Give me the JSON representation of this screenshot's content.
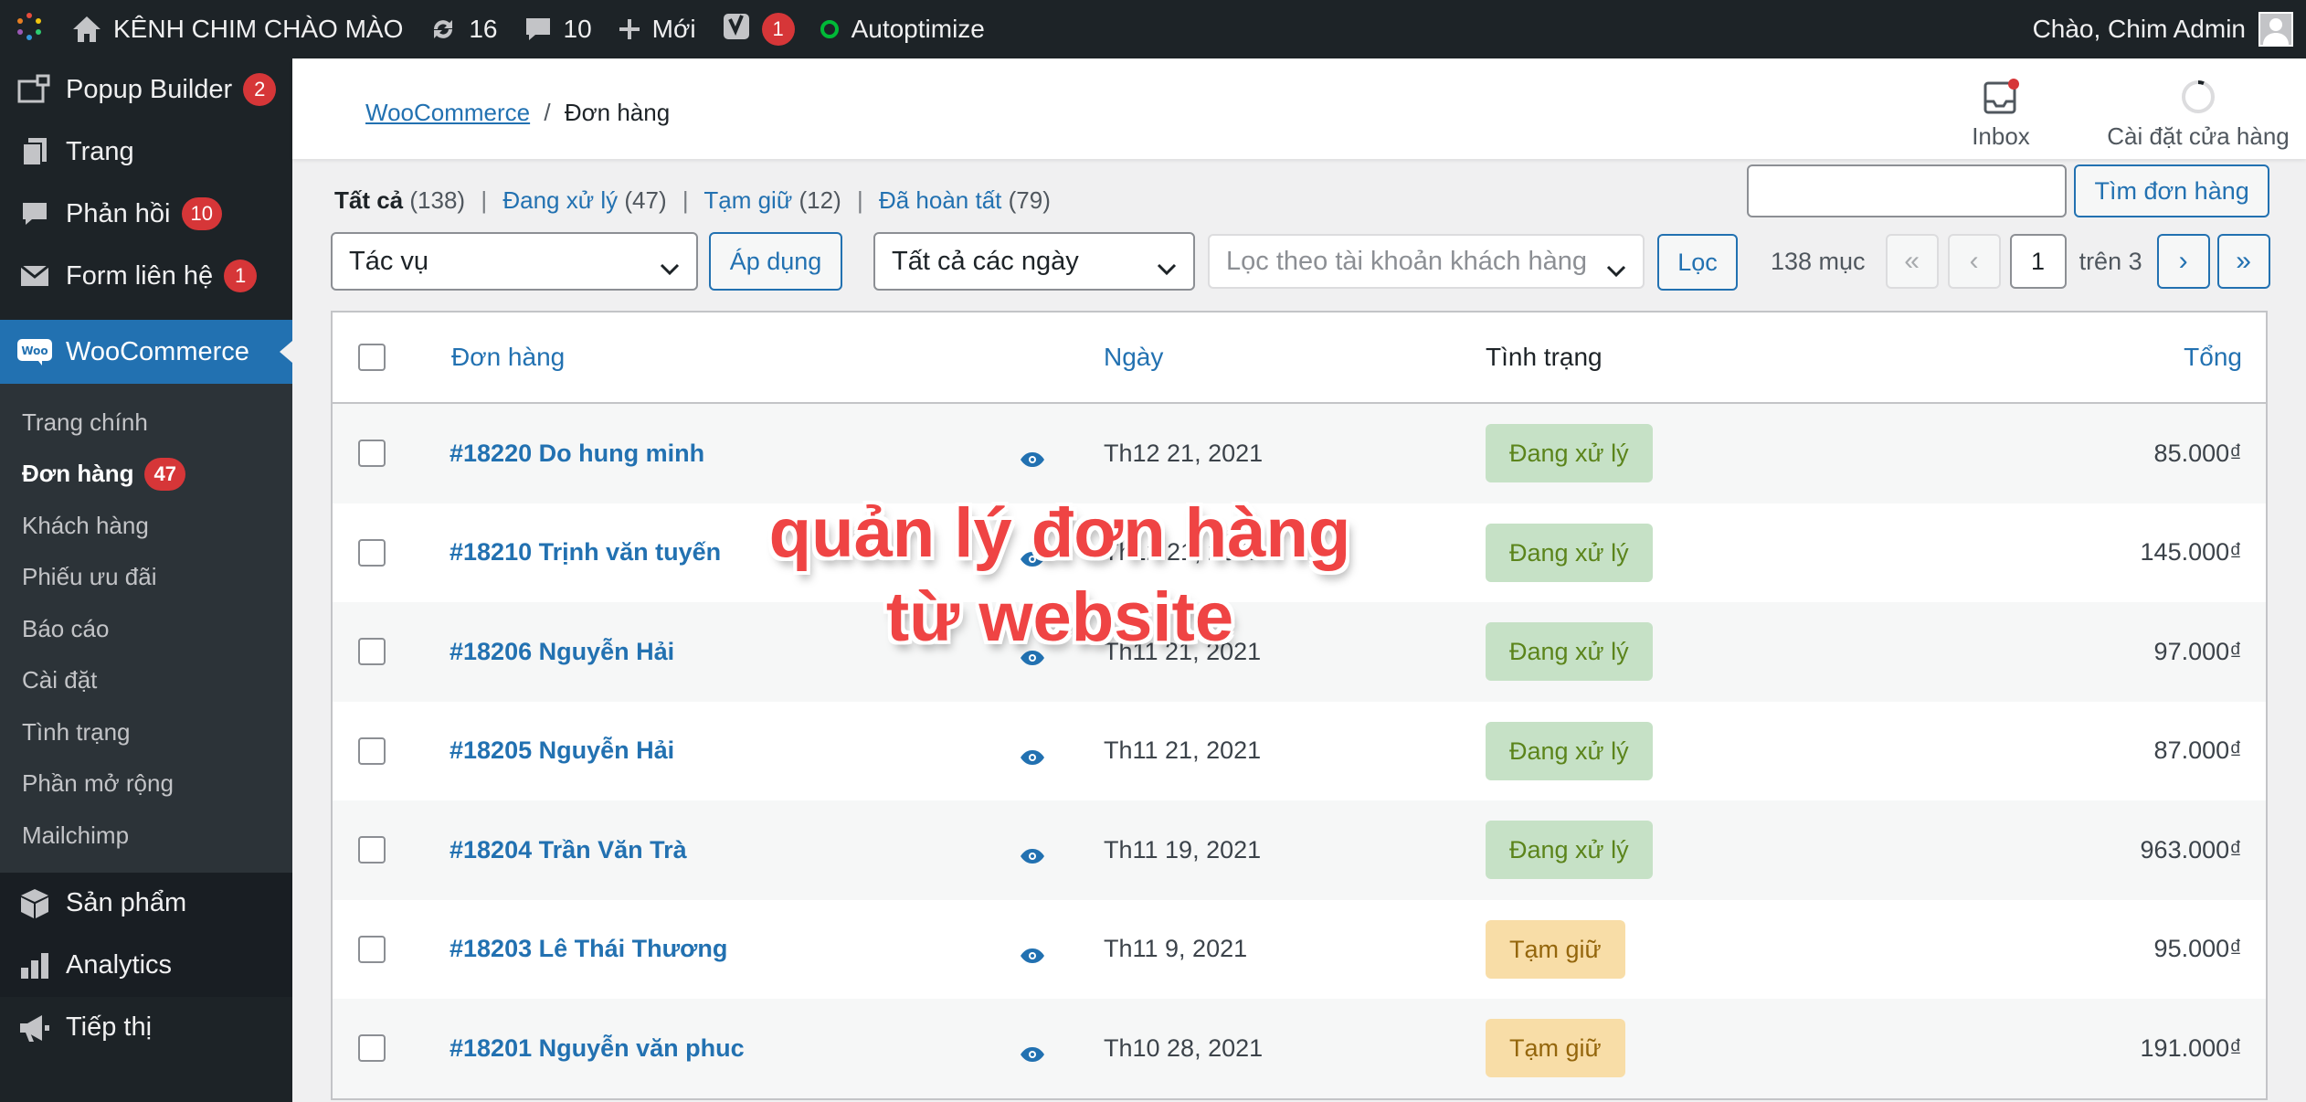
{
  "adminbar": {
    "site_name": "KÊNH CHIM CHÀO MÀO",
    "updates_count": "16",
    "comments_count": "10",
    "new_label": "Mới",
    "yoast_count": "1",
    "autoptimize_label": "Autoptimize",
    "greeting": "Chào, Chim Admin"
  },
  "sidebar": {
    "top_items": [
      {
        "label": "Popup Builder",
        "badge": "2",
        "icon": "popup-icon"
      },
      {
        "label": "Trang",
        "badge": "",
        "icon": "pages-icon"
      },
      {
        "label": "Phản hồi",
        "badge": "10",
        "icon": "comments-icon"
      },
      {
        "label": "Form liên hệ",
        "badge": "1",
        "icon": "mail-icon"
      }
    ],
    "current": {
      "label": "WooCommerce",
      "icon": "woo-icon",
      "icon_text": "Woo"
    },
    "submenu": [
      {
        "label": "Trang chính",
        "badge": ""
      },
      {
        "label": "Đơn hàng",
        "badge": "47"
      },
      {
        "label": "Khách hàng",
        "badge": ""
      },
      {
        "label": "Phiếu ưu đãi",
        "badge": ""
      },
      {
        "label": "Báo cáo",
        "badge": ""
      },
      {
        "label": "Cài đặt",
        "badge": ""
      },
      {
        "label": "Tình trạng",
        "badge": ""
      },
      {
        "label": "Phần mở rộng",
        "badge": ""
      },
      {
        "label": "Mailchimp",
        "badge": ""
      }
    ],
    "bottom_items": [
      {
        "label": "Sản phẩm",
        "icon": "box-icon"
      },
      {
        "label": "Analytics",
        "icon": "bar-chart-icon"
      },
      {
        "label": "Tiếp thị",
        "icon": "megaphone-icon"
      }
    ]
  },
  "header": {
    "breadcrumb_link": "WooCommerce",
    "breadcrumb_sep": "/",
    "breadcrumb_current": "Đơn hàng",
    "inbox_label": "Inbox",
    "setup_label": "Cài đặt cửa hàng"
  },
  "filters": {
    "all_label": "Tất cả",
    "all_count": "(138)",
    "processing_label": "Đang xử lý",
    "processing_count": "(47)",
    "onhold_label": "Tạm giữ",
    "onhold_count": "(12)",
    "completed_label": "Đã hoàn tất",
    "completed_count": "(79)",
    "separator": "|"
  },
  "search": {
    "value": "",
    "button_label": "Tìm đơn hàng"
  },
  "toolbar": {
    "bulk_action": "Tác vụ",
    "apply_label": "Áp dụng",
    "date_filter": "Tất cả các ngày",
    "customer_placeholder": "Lọc theo tài khoản khách hàng",
    "filter_label": "Lọc",
    "items_count": "138 mục",
    "first_page": "«",
    "prev_page": "‹",
    "current_page": "1",
    "of_pages": "trên 3",
    "next_page": "›",
    "last_page": "»"
  },
  "table": {
    "columns": {
      "order": "Đơn hàng",
      "date": "Ngày",
      "status": "Tình trạng",
      "total": "Tổng"
    },
    "rows": [
      {
        "order": "#18220 Do hung minh",
        "date": "Th12 21, 2021",
        "status": "Đang xử lý",
        "status_type": "processing",
        "total": "85.000₫"
      },
      {
        "order": "#18210 Trịnh văn tuyến",
        "date": "Th12 21, 2021",
        "status": "Đang xử lý",
        "status_type": "processing",
        "total": "145.000₫"
      },
      {
        "order": "#18206 Nguyễn Hải",
        "date": "Th11 21, 2021",
        "status": "Đang xử lý",
        "status_type": "processing",
        "total": "97.000₫"
      },
      {
        "order": "#18205 Nguyễn Hải",
        "date": "Th11 21, 2021",
        "status": "Đang xử lý",
        "status_type": "processing",
        "total": "87.000₫"
      },
      {
        "order": "#18204 Trần Văn Trà",
        "date": "Th11 19, 2021",
        "status": "Đang xử lý",
        "status_type": "processing",
        "total": "963.000₫"
      },
      {
        "order": "#18203 Lê Thái Thương",
        "date": "Th11 9, 2021",
        "status": "Tạm giữ",
        "status_type": "on-hold",
        "total": "95.000₫"
      },
      {
        "order": "#18201 Nguyễn văn phuc",
        "date": "Th10 28, 2021",
        "status": "Tạm giữ",
        "status_type": "on-hold",
        "total": "191.000₫"
      }
    ]
  },
  "overlay": {
    "line1": "quản lý đơn hàng",
    "line2": "từ website"
  },
  "colors": {
    "admin_dark": "#1d2327",
    "accent": "#2271b1",
    "badge_red": "#d63638",
    "processing_bg": "#c6e1c6",
    "processing_text": "#5b841b",
    "onhold_bg": "#f8dda7",
    "onhold_text": "#94660c",
    "overlay_red": "#ef4444"
  }
}
